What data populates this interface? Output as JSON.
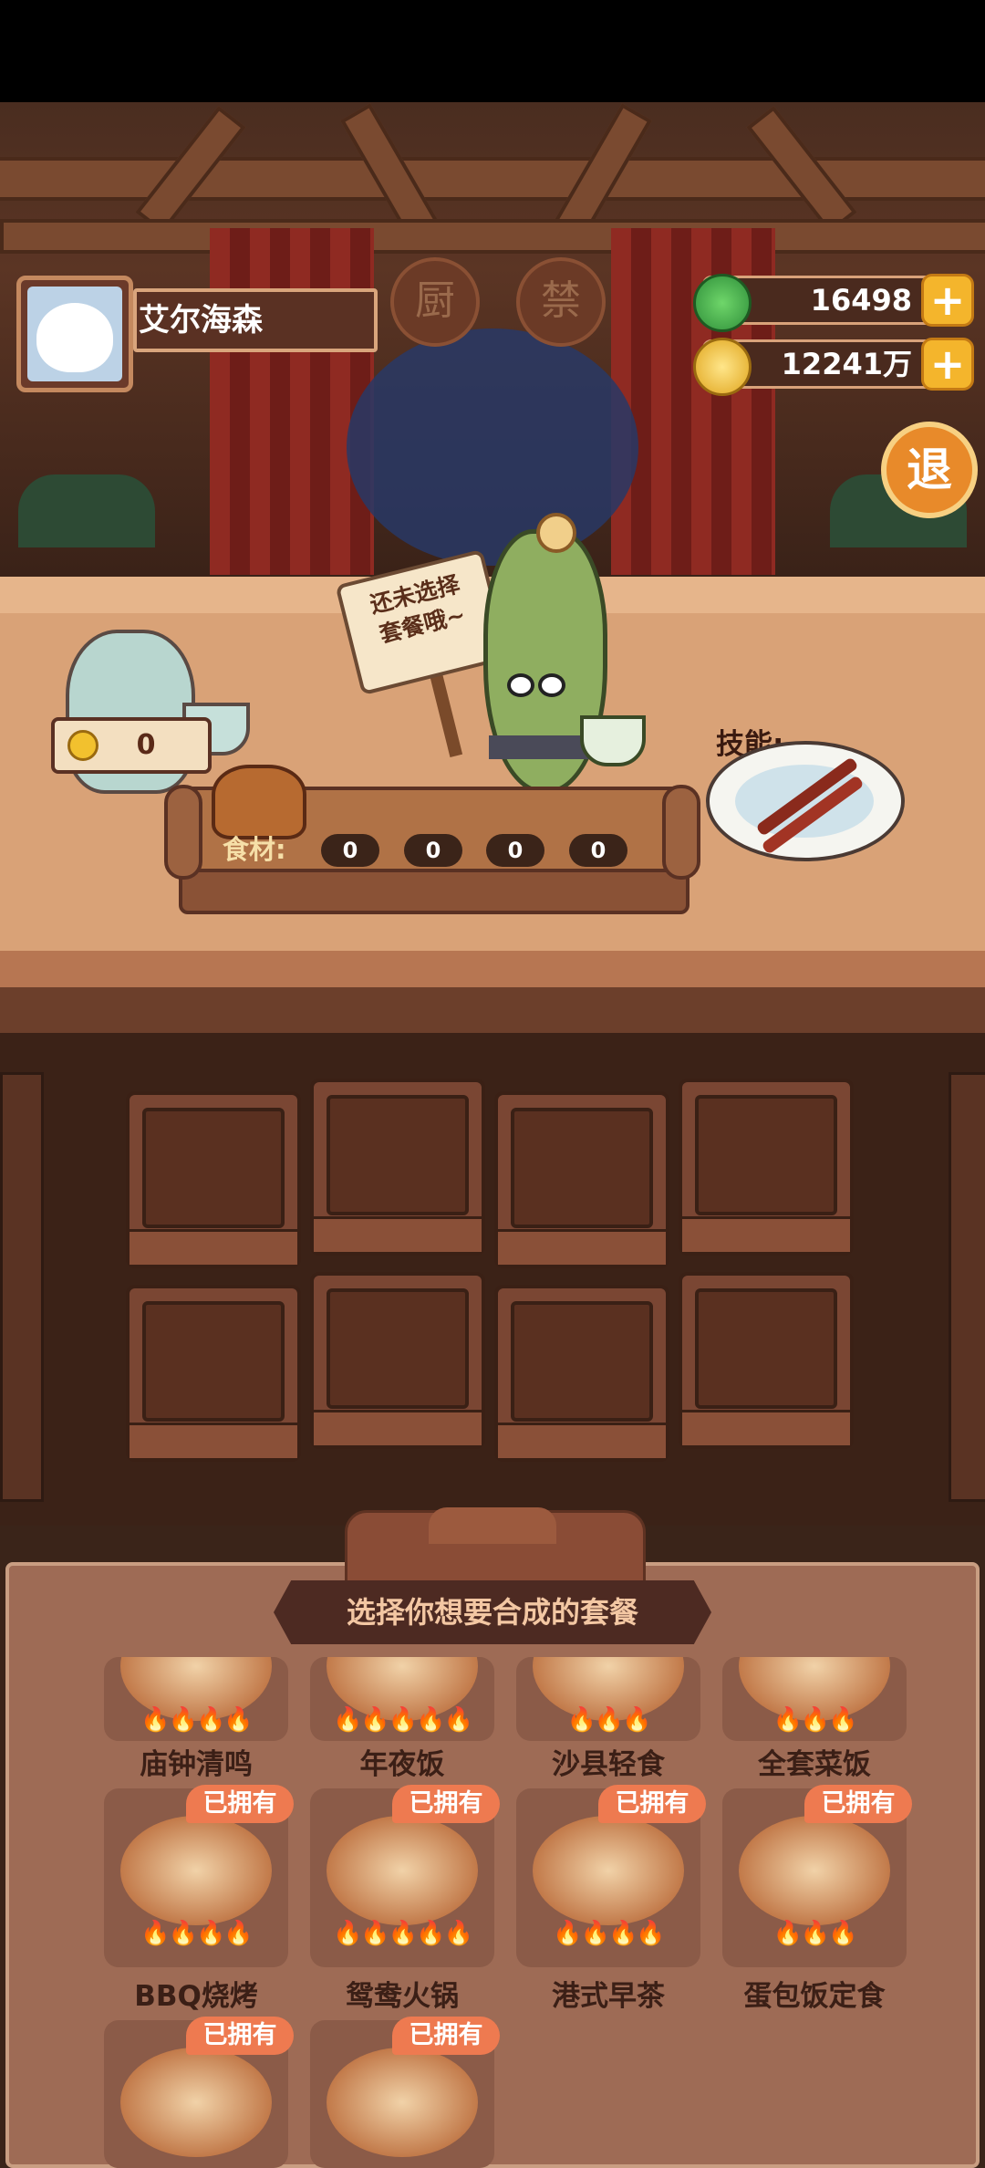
{
  "player": {
    "name": "艾尔海森"
  },
  "resources": {
    "jade": {
      "value": "16498",
      "icon": "jade-orb-icon",
      "color": "#2f8f3a"
    },
    "coins": {
      "value": "12241万",
      "icon": "coin-icon",
      "color": "#f2c12e"
    },
    "plus_label": "+"
  },
  "exit_button": {
    "label": "退"
  },
  "stage_signs": [
    "厨",
    "禁"
  ],
  "counter": {
    "price": "0",
    "sign_text": "还未选择\n套餐哦~",
    "skill_label": "技能:",
    "ingredients_label": "食材:",
    "ingredients": [
      "0",
      "0",
      "0",
      "0"
    ]
  },
  "panel": {
    "title": "选择你想要合成的套餐",
    "owned_badge": "已拥有",
    "top_row": [
      "庙钟清鸣",
      "年夜饭",
      "沙县轻食",
      "全套菜饭"
    ],
    "mid_row": [
      "BBQ烧烤",
      "鸳鸯火锅",
      "港式早茶",
      "蛋包饭定食"
    ],
    "bottom_row_owned": 2,
    "flames": {
      "top": [
        "🔥🔥🔥🔥",
        "🔥🔥🔥🔥🔥",
        "🔥🔥🔥",
        "🔥🔥🔥"
      ],
      "mid": [
        "🔥🔥🔥🔥",
        "🔥🔥🔥🔥🔥",
        "🔥🔥🔥🔥",
        "🔥🔥🔥"
      ]
    }
  },
  "colors": {
    "accent_orange": "#ee7a50",
    "panel_bg": "#9e6b55",
    "gold": "#f4b52c"
  }
}
